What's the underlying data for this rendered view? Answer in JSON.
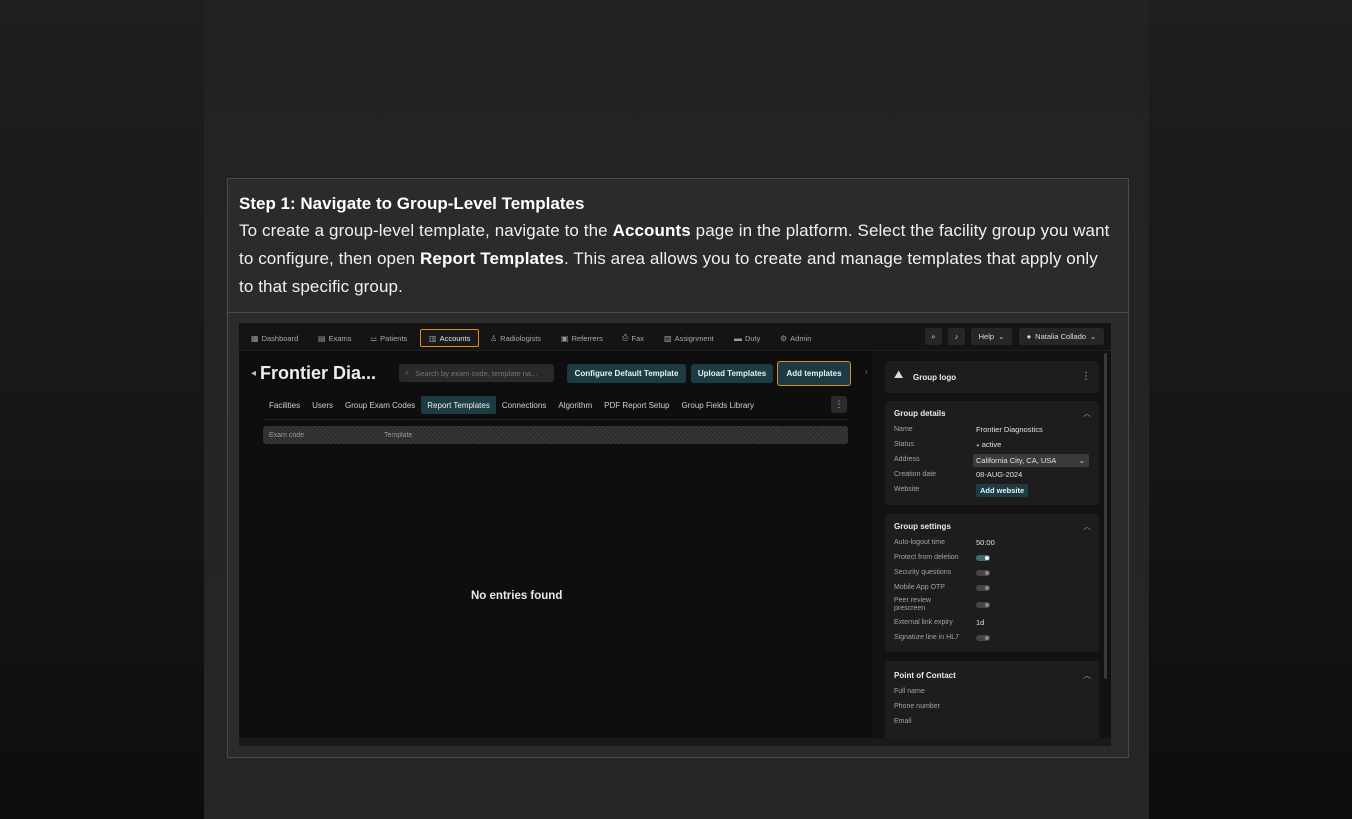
{
  "doc": {
    "step_title": "Step 1: Navigate to Group-Level Templates",
    "body_1": "To create a group-level template, navigate to the ",
    "body_accounts": "Accounts",
    "body_2": " page in the platform. Select the facility group you want to configure, then open ",
    "body_report_templates": "Report Templates",
    "body_3": ". This area allows you to create and manage templates that apply only to that specific group."
  },
  "nav": {
    "items": [
      {
        "label": "Dashboard",
        "icon": "dashboard-icon"
      },
      {
        "label": "Exams",
        "icon": "exams-icon"
      },
      {
        "label": "Patients",
        "icon": "patients-icon"
      },
      {
        "label": "Accounts",
        "icon": "accounts-icon",
        "active": true
      },
      {
        "label": "Radiologists",
        "icon": "radiologist-icon"
      },
      {
        "label": "Referrers",
        "icon": "referrers-icon"
      },
      {
        "label": "Fax",
        "icon": "fax-icon"
      },
      {
        "label": "Assignment",
        "icon": "assignment-icon"
      },
      {
        "label": "Duty",
        "icon": "duty-icon"
      },
      {
        "label": "Admin",
        "icon": "admin-icon"
      }
    ],
    "help": "Help",
    "user": "Natalia Collado"
  },
  "main": {
    "title": "Frontier Dia...",
    "search_placeholder": "Search by exam code, template na...",
    "configure_btn": "Configure Default Template",
    "upload_btn": "Upload Templates",
    "add_btn": "Add templates",
    "tabs": [
      "Facilities",
      "Users",
      "Group Exam Codes",
      "Report Templates",
      "Connections",
      "Algorithm",
      "PDF Report Setup",
      "Group Fields Library"
    ],
    "active_tab": "Report Templates",
    "table_cols": [
      "Exam code",
      "Template"
    ],
    "empty": "No entries found"
  },
  "panel": {
    "logo_title": "Group logo",
    "details": {
      "title": "Group details",
      "name_label": "Name",
      "name_value": "Frontier Diagnostics",
      "status_label": "Status",
      "status_value": "active",
      "address_label": "Address",
      "address_value": "California City, CA, USA",
      "date_label": "Creation date",
      "date_value": "08-AUG-2024",
      "website_label": "Website",
      "website_btn": "Add website"
    },
    "settings": {
      "title": "Group settings",
      "autologout_label": "Auto-logout time",
      "autologout_value": "50:00",
      "protect_label": "Protect from deletion",
      "protect_on": true,
      "security_label": "Security questions",
      "security_on": false,
      "otp_label": "Mobile App OTP",
      "otp_on": false,
      "peer_label": "Peer review prescreen",
      "peer_on": false,
      "expiry_label": "External link expiry",
      "expiry_value": "1d",
      "signature_label": "Signature line in HL7",
      "signature_on": false
    },
    "contact": {
      "title": "Point of Contact",
      "fullname_label": "Full name",
      "phone_label": "Phone number",
      "email_label": "Email"
    }
  }
}
